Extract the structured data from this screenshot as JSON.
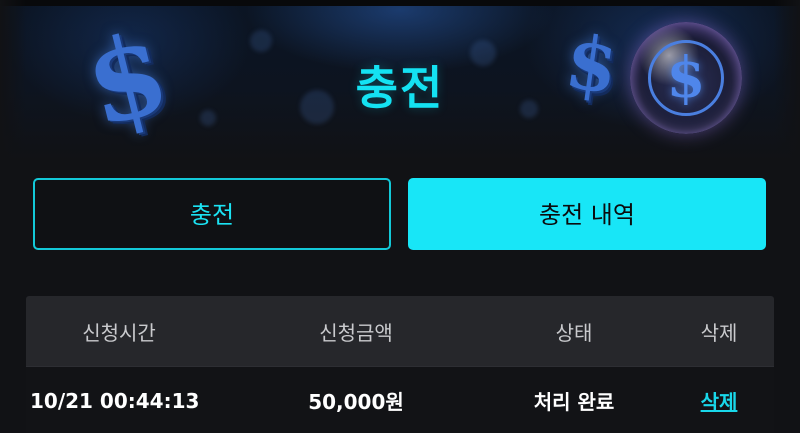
{
  "banner": {
    "title": "충전",
    "dollar_glyph": "$",
    "accent_color": "#14e2f2"
  },
  "tabs": [
    {
      "label": "충전",
      "active": false
    },
    {
      "label": "충전 내역",
      "active": true
    }
  ],
  "table": {
    "headers": [
      "신청시간",
      "신청금액",
      "상태",
      "삭제"
    ],
    "rows": [
      {
        "time": "10/21 00:44:13",
        "amount": "50,000원",
        "status": "처리 완료",
        "delete_label": "삭제"
      }
    ]
  },
  "colors": {
    "background": "#111215",
    "accent": "#18e6f7",
    "header_bg": "#26272b",
    "link": "#19d8ea"
  },
  "icons": [
    "dollar-sign-icon",
    "dollar-coin-icon"
  ]
}
